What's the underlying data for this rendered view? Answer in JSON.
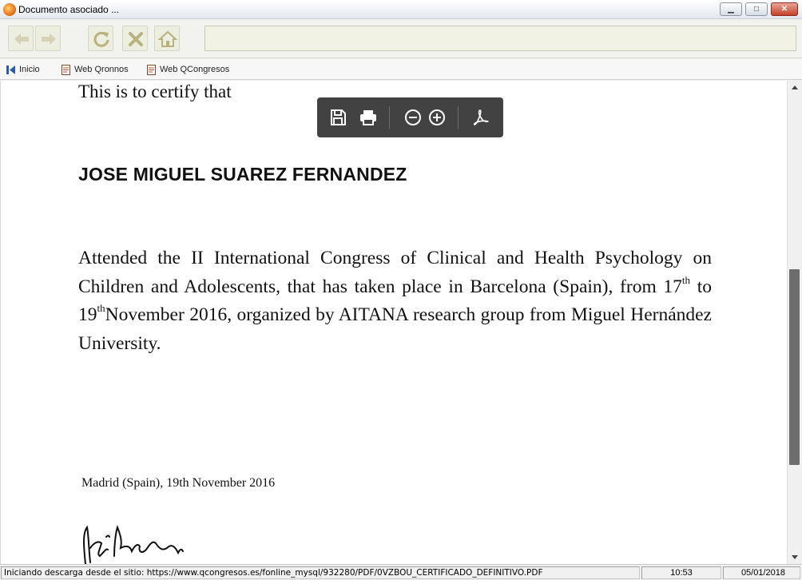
{
  "window": {
    "title": "Documento asociado ...",
    "minimize_glyph": "▁",
    "maximize_glyph": "□",
    "close_glyph": "✕"
  },
  "toolbar": {
    "icons": [
      "back-arrow-icon",
      "forward-arrow-icon",
      "refresh-icon",
      "stop-icon",
      "home-icon"
    ],
    "address_value": ""
  },
  "links": [
    {
      "label": "Inicio",
      "icon": "home-page-icon"
    },
    {
      "label": "Web Qronnos",
      "icon": "web-page-icon"
    },
    {
      "label": "Web QCongresos",
      "icon": "web-page-icon"
    }
  ],
  "document": {
    "certify_line": "This is to certify that",
    "recipient_name": "JOSE MIGUEL SUAREZ FERNANDEZ",
    "body": {
      "part1": "Attended the II International Congress of Clinical and Health Psychology on Children and Adolescents, that has taken place in Barcelona (Spain), from 17",
      "sup1": "th",
      "part2": " to 19",
      "sup2": "th",
      "part3": "November 2016, organized by AITANA research group from Miguel Hernández University."
    },
    "dateline": "Madrid (Spain), 19th November 2016"
  },
  "pdf_toolbar": {
    "icons": [
      "save-icon",
      "print-icon",
      "zoom-out-icon",
      "zoom-in-icon",
      "acrobat-icon"
    ]
  },
  "statusbar": {
    "message": "Iniciando descarga desde el sitio: https://www.qcongresos.es/fonline_mysql/932280/PDF/0VZBOU_CERTIFICADO_DEFINITIVO.PDF",
    "time": "10:53",
    "date": "05/01/2018"
  },
  "colors": {
    "pdf_toolbar_bg": "#3c3c3c",
    "toolbar_icon": "#c8c29a",
    "scroll_thumb": "#6d6d6d"
  }
}
